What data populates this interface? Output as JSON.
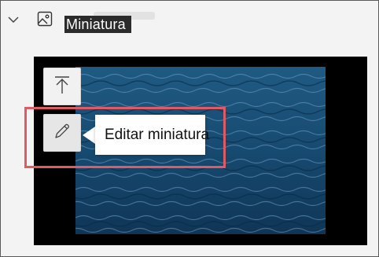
{
  "section": {
    "title": "Miniatura",
    "expand_icon": "chevron-down-icon",
    "thumbnail_icon": "image-icon"
  },
  "preview": {
    "image": "ocean-water-photo",
    "tools": [
      {
        "name": "upload-thumbnail-button",
        "icon": "upload-arrow-icon"
      },
      {
        "name": "edit-thumbnail-button",
        "icon": "pencil-icon"
      }
    ]
  },
  "tooltip": {
    "text": "Editar miniatura"
  },
  "colors": {
    "highlight_border": "#e05a63",
    "title_background": "#2b2b2b",
    "panel_background": "#f3f3f3",
    "preview_background": "#000000"
  }
}
